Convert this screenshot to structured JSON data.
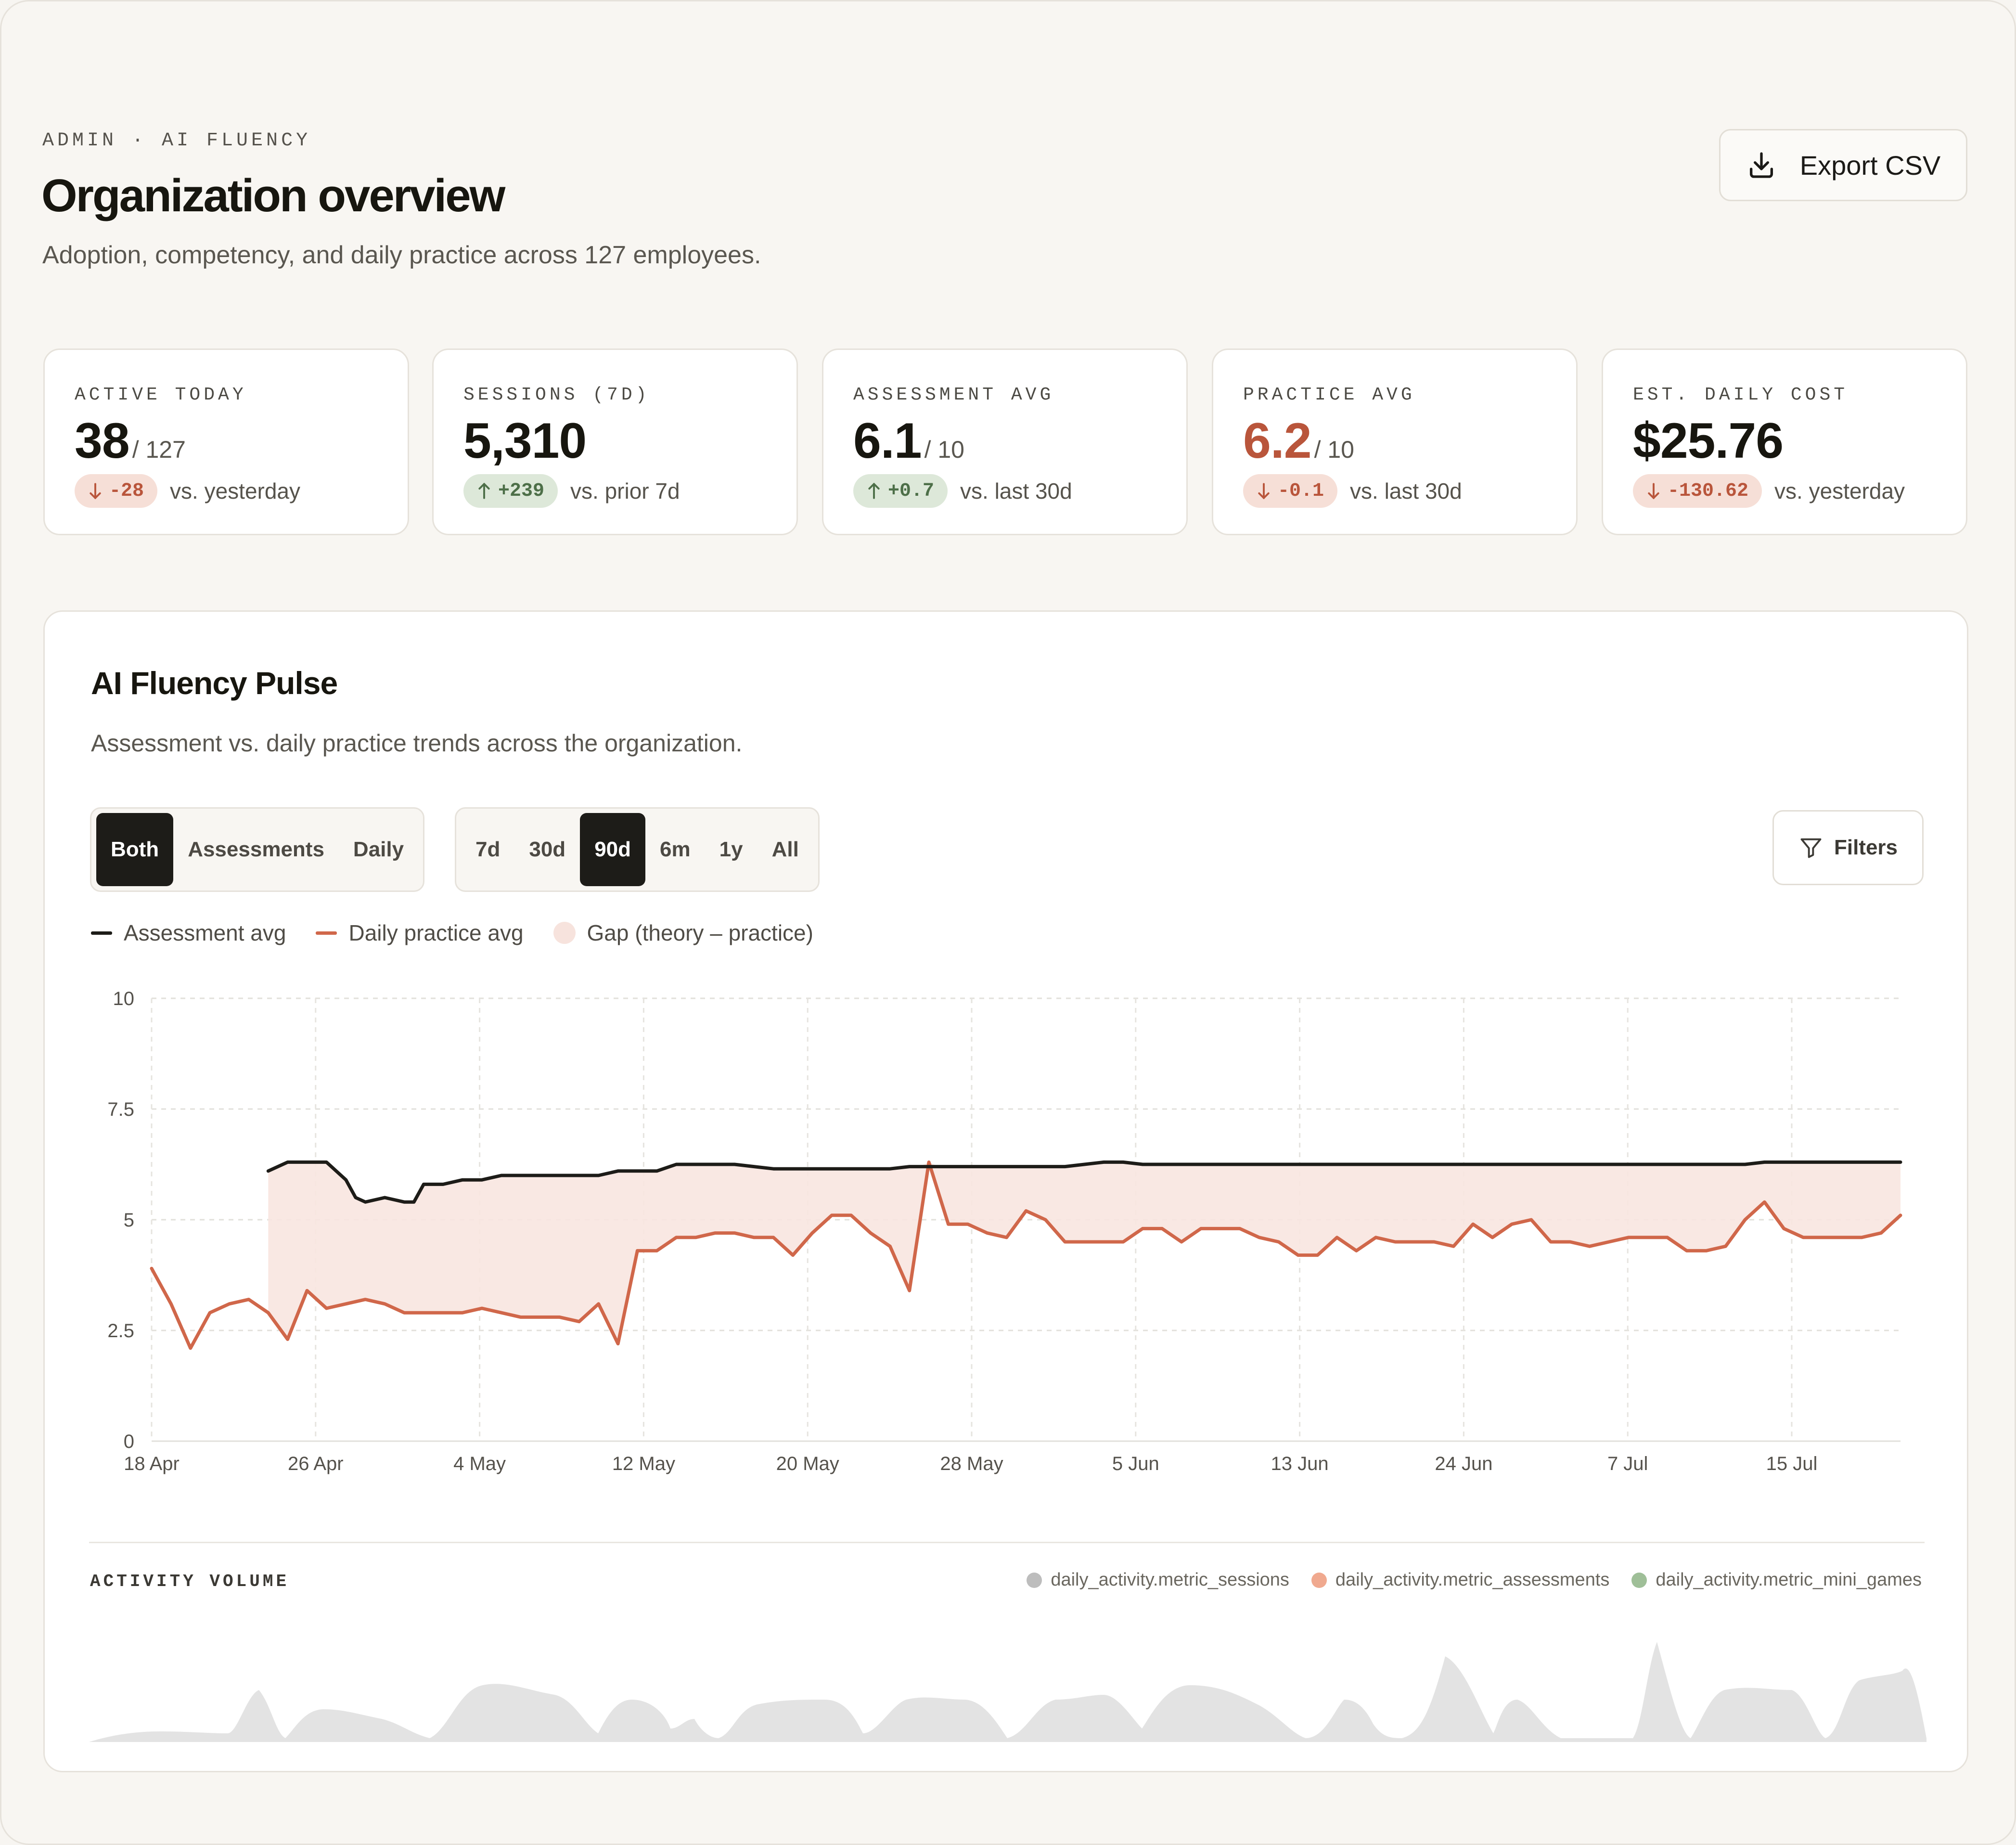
{
  "header": {
    "eyebrow": "ADMIN · AI FLUENCY",
    "title": "Organization overview",
    "subtitle": "Adoption, competency, and daily practice across 127 employees.",
    "export_label": "Export CSV"
  },
  "kpis": [
    {
      "label": "ACTIVE TODAY",
      "value": "38",
      "suffix": "/ 127",
      "delta": "-28",
      "direction": "down",
      "comparison": "vs. yesterday"
    },
    {
      "label": "SESSIONS (7D)",
      "value": "5,310",
      "suffix": "",
      "delta": "+239",
      "direction": "up",
      "comparison": "vs. prior 7d"
    },
    {
      "label": "ASSESSMENT AVG",
      "value": "6.1",
      "suffix": "/ 10",
      "delta": "+0.7",
      "direction": "up",
      "comparison": "vs. last 30d"
    },
    {
      "label": "PRACTICE AVG",
      "value": "6.2",
      "suffix": "/ 10",
      "delta": "-0.1",
      "direction": "down",
      "comparison": "vs. last 30d"
    },
    {
      "label": "EST. DAILY COST",
      "value": "$25.76",
      "suffix": "",
      "delta": "-130.62",
      "direction": "down",
      "comparison": "vs. yesterday"
    }
  ],
  "pulse": {
    "title": "AI Fluency Pulse",
    "subtitle": "Assessment vs. daily practice trends across the organization.",
    "view_toggle": [
      "Both",
      "Assessments",
      "Daily"
    ],
    "view_selected": "Both",
    "range_toggle": [
      "7d",
      "30d",
      "90d",
      "6m",
      "1y",
      "All"
    ],
    "range_selected": "90d",
    "filters_label": "Filters",
    "legend": [
      {
        "label": "Assessment avg",
        "color": "#1d1c18",
        "kind": "line"
      },
      {
        "label": "Daily practice avg",
        "color": "#d0674a",
        "kind": "line"
      },
      {
        "label": "Gap (theory – practice)",
        "color": "#f7e3dd",
        "kind": "dot"
      }
    ]
  },
  "activity": {
    "title": "ACTIVITY VOLUME",
    "legend": [
      {
        "label": "daily_activity.metric_sessions",
        "color": "#bdbdbd"
      },
      {
        "label": "daily_activity.metric_assessments",
        "color": "#f0a98f"
      },
      {
        "label": "daily_activity.metric_mini_games",
        "color": "#9fbf98"
      }
    ]
  },
  "icons": {
    "export": "download-icon",
    "filters": "filter-icon",
    "delta_up": "arrow-up-icon",
    "delta_down": "arrow-down-icon"
  },
  "chart_data": {
    "type": "line",
    "y_ticks": [
      "0",
      "2.5",
      "5",
      "7.5",
      "10"
    ],
    "ylim": [
      0,
      10
    ],
    "x_tick_labels": [
      "18 Apr",
      "26 Apr",
      "4 May",
      "12 May",
      "20 May",
      "28 May",
      "5 Jun",
      "13 Jun",
      "24 Jun",
      "7 Jul",
      "15 Jul"
    ],
    "grid": true,
    "series": [
      {
        "name": "Assessment avg",
        "color": "#1d1c18",
        "points": [
          [
            6,
            6.1
          ],
          [
            7,
            6.3
          ],
          [
            8,
            6.3
          ],
          [
            9,
            6.3
          ],
          [
            10,
            5.9
          ],
          [
            10.5,
            5.5
          ],
          [
            11,
            5.4
          ],
          [
            12,
            5.5
          ],
          [
            13,
            5.4
          ],
          [
            13.5,
            5.4
          ],
          [
            14,
            5.8
          ],
          [
            15,
            5.8
          ],
          [
            16,
            5.9
          ],
          [
            17,
            5.9
          ],
          [
            18,
            6.0
          ],
          [
            19,
            6.0
          ],
          [
            20,
            6.0
          ],
          [
            21,
            6.0
          ],
          [
            22,
            6.0
          ],
          [
            23,
            6.0
          ],
          [
            24,
            6.1
          ],
          [
            25,
            6.1
          ],
          [
            26,
            6.1
          ],
          [
            27,
            6.25
          ],
          [
            28,
            6.25
          ],
          [
            29,
            6.25
          ],
          [
            30,
            6.25
          ],
          [
            31,
            6.2
          ],
          [
            32,
            6.15
          ],
          [
            33,
            6.15
          ],
          [
            34,
            6.15
          ],
          [
            35,
            6.15
          ],
          [
            36,
            6.15
          ],
          [
            37,
            6.15
          ],
          [
            38,
            6.15
          ],
          [
            39,
            6.2
          ],
          [
            40,
            6.2
          ],
          [
            41,
            6.2
          ],
          [
            42,
            6.2
          ],
          [
            43,
            6.2
          ],
          [
            44,
            6.2
          ],
          [
            45,
            6.2
          ],
          [
            46,
            6.2
          ],
          [
            47,
            6.2
          ],
          [
            48,
            6.25
          ],
          [
            49,
            6.3
          ],
          [
            50,
            6.3
          ],
          [
            51,
            6.25
          ],
          [
            52,
            6.25
          ],
          [
            53,
            6.25
          ],
          [
            54,
            6.25
          ],
          [
            55,
            6.25
          ],
          [
            56,
            6.25
          ],
          [
            57,
            6.25
          ],
          [
            58,
            6.25
          ],
          [
            59,
            6.25
          ],
          [
            60,
            6.25
          ],
          [
            61,
            6.25
          ],
          [
            62,
            6.25
          ],
          [
            63,
            6.25
          ],
          [
            64,
            6.25
          ],
          [
            65,
            6.25
          ],
          [
            66,
            6.25
          ],
          [
            67,
            6.25
          ],
          [
            68,
            6.25
          ],
          [
            69,
            6.25
          ],
          [
            70,
            6.25
          ],
          [
            71,
            6.25
          ],
          [
            72,
            6.25
          ],
          [
            73,
            6.25
          ],
          [
            74,
            6.25
          ],
          [
            75,
            6.25
          ],
          [
            76,
            6.25
          ],
          [
            77,
            6.25
          ],
          [
            78,
            6.25
          ],
          [
            79,
            6.25
          ],
          [
            80,
            6.25
          ],
          [
            81,
            6.25
          ],
          [
            82,
            6.25
          ],
          [
            83,
            6.3
          ],
          [
            84,
            6.3
          ],
          [
            85,
            6.3
          ],
          [
            86,
            6.3
          ],
          [
            87,
            6.3
          ],
          [
            88,
            6.3
          ],
          [
            89,
            6.3
          ],
          [
            90,
            6.3
          ]
        ]
      },
      {
        "name": "Daily practice avg",
        "color": "#d0674a",
        "points": [
          [
            0,
            3.9
          ],
          [
            1,
            3.1
          ],
          [
            2,
            2.1
          ],
          [
            3,
            2.9
          ],
          [
            4,
            3.1
          ],
          [
            5,
            3.2
          ],
          [
            6,
            2.9
          ],
          [
            7,
            2.3
          ],
          [
            8,
            3.4
          ],
          [
            9,
            3.0
          ],
          [
            10,
            3.1
          ],
          [
            11,
            3.2
          ],
          [
            12,
            3.1
          ],
          [
            13,
            2.9
          ],
          [
            14,
            2.9
          ],
          [
            15,
            2.9
          ],
          [
            16,
            2.9
          ],
          [
            17,
            3.0
          ],
          [
            18,
            2.9
          ],
          [
            19,
            2.8
          ],
          [
            20,
            2.8
          ],
          [
            21,
            2.8
          ],
          [
            22,
            2.7
          ],
          [
            23,
            3.1
          ],
          [
            24,
            2.2
          ],
          [
            25,
            4.3
          ],
          [
            26,
            4.3
          ],
          [
            27,
            4.6
          ],
          [
            28,
            4.6
          ],
          [
            29,
            4.7
          ],
          [
            30,
            4.7
          ],
          [
            31,
            4.6
          ],
          [
            32,
            4.6
          ],
          [
            33,
            4.2
          ],
          [
            34,
            4.7
          ],
          [
            35,
            5.1
          ],
          [
            36,
            5.1
          ],
          [
            37,
            4.7
          ],
          [
            38,
            4.4
          ],
          [
            39,
            3.4
          ],
          [
            40,
            6.3
          ],
          [
            41,
            4.9
          ],
          [
            42,
            4.9
          ],
          [
            43,
            4.7
          ],
          [
            44,
            4.6
          ],
          [
            45,
            5.2
          ],
          [
            46,
            5.0
          ],
          [
            47,
            4.5
          ],
          [
            48,
            4.5
          ],
          [
            49,
            4.5
          ],
          [
            50,
            4.5
          ],
          [
            51,
            4.8
          ],
          [
            52,
            4.8
          ],
          [
            53,
            4.5
          ],
          [
            54,
            4.8
          ],
          [
            55,
            4.8
          ],
          [
            56,
            4.8
          ],
          [
            57,
            4.6
          ],
          [
            58,
            4.5
          ],
          [
            59,
            4.2
          ],
          [
            60,
            4.2
          ],
          [
            61,
            4.6
          ],
          [
            62,
            4.3
          ],
          [
            63,
            4.6
          ],
          [
            64,
            4.5
          ],
          [
            65,
            4.5
          ],
          [
            66,
            4.5
          ],
          [
            67,
            4.4
          ],
          [
            68,
            4.9
          ],
          [
            69,
            4.6
          ],
          [
            70,
            4.9
          ],
          [
            71,
            5.0
          ],
          [
            72,
            4.5
          ],
          [
            73,
            4.5
          ],
          [
            74,
            4.4
          ],
          [
            75,
            4.5
          ],
          [
            76,
            4.6
          ],
          [
            77,
            4.6
          ],
          [
            78,
            4.6
          ],
          [
            79,
            4.3
          ],
          [
            80,
            4.3
          ],
          [
            81,
            4.4
          ],
          [
            82,
            5.0
          ],
          [
            83,
            5.4
          ],
          [
            84,
            4.8
          ],
          [
            85,
            4.6
          ],
          [
            86,
            4.6
          ],
          [
            87,
            4.6
          ],
          [
            88,
            4.6
          ],
          [
            89,
            4.7
          ],
          [
            90,
            5.1
          ]
        ]
      }
    ]
  }
}
